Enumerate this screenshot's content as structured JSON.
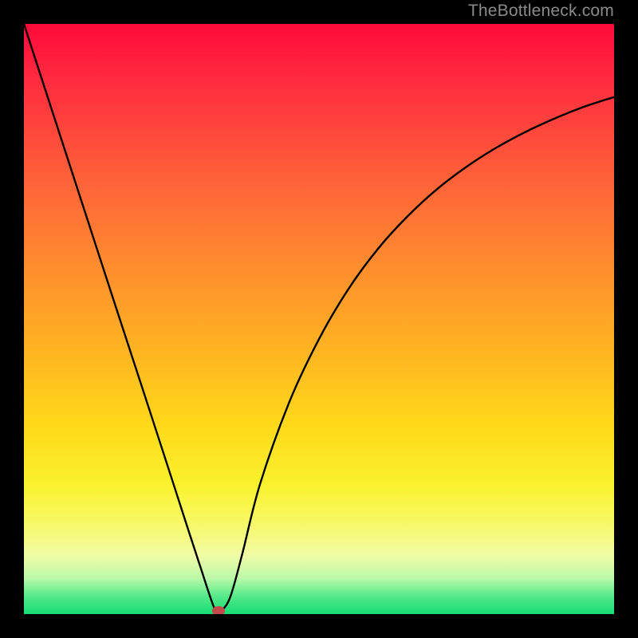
{
  "attribution": "TheBottleneck.com",
  "colors": {
    "background": "#000000",
    "curve": "#000000",
    "marker": "#c54b4b",
    "attribution_text": "#8a8a8a"
  },
  "chart_data": {
    "type": "line",
    "title": "",
    "xlabel": "",
    "ylabel": "",
    "xlim": [
      0,
      100
    ],
    "ylim": [
      0,
      100
    ],
    "x": [
      0,
      5,
      10,
      15,
      20,
      25,
      28,
      30,
      31.5,
      32.5,
      33.5,
      35,
      37,
      40,
      45,
      50,
      55,
      60,
      65,
      70,
      75,
      80,
      85,
      90,
      95,
      100
    ],
    "y": [
      100,
      84.6,
      69.2,
      53.8,
      38.5,
      23.1,
      13.8,
      7.7,
      3.1,
      0.6,
      0.6,
      3.0,
      10.2,
      22.0,
      36.0,
      46.6,
      55.1,
      61.9,
      67.4,
      72.0,
      75.8,
      79.0,
      81.7,
      84.0,
      86.0,
      87.6
    ],
    "marker": {
      "x": 33,
      "y": 0.6
    },
    "grid": false,
    "legend": false
  }
}
